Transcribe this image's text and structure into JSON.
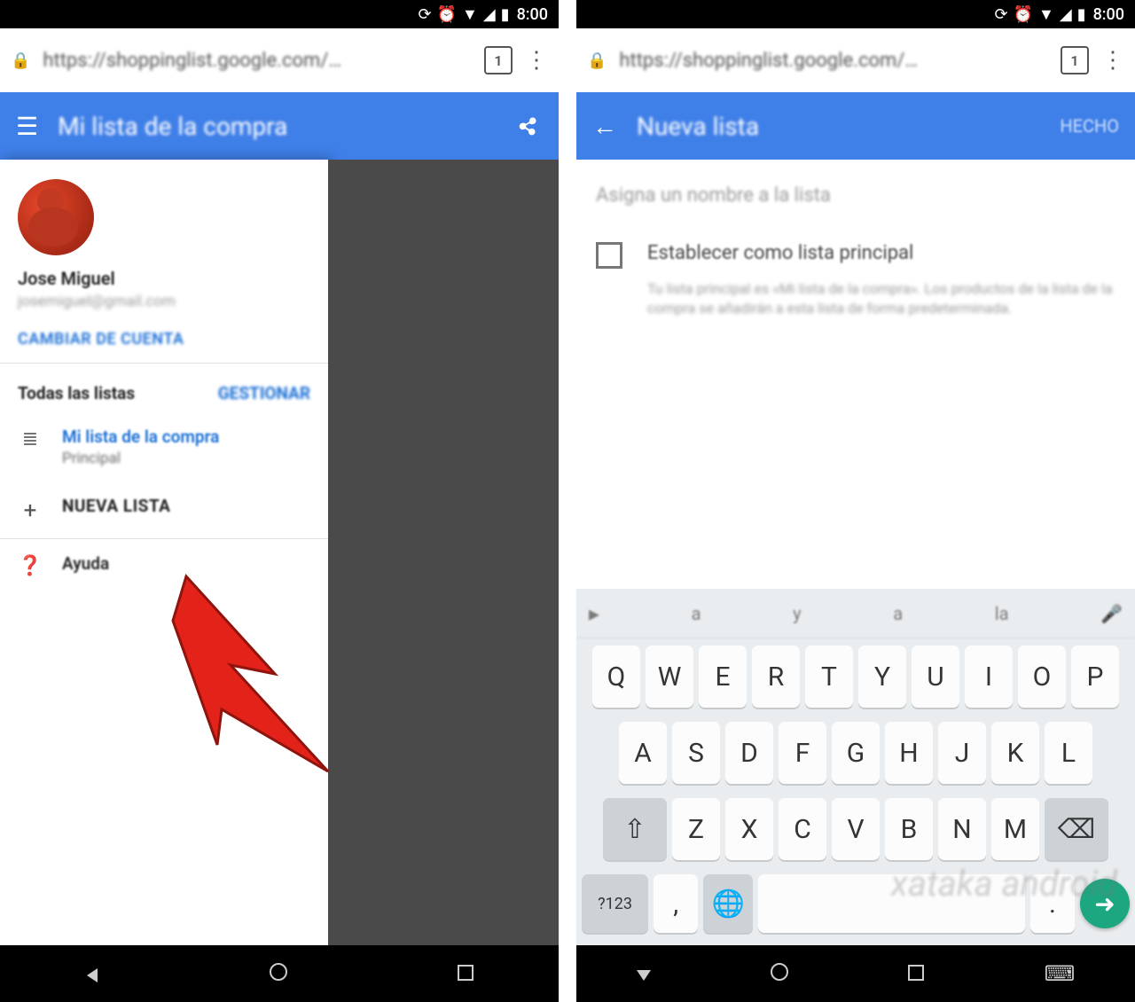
{
  "status": {
    "time": "8:00",
    "icons": [
      "sync-icon",
      "alarm-icon",
      "wifi-icon",
      "signal-icon",
      "battery-icon"
    ]
  },
  "browser": {
    "url": "https://shoppinglist.google.com/…",
    "tab_count": "1"
  },
  "left": {
    "header_title": "Mi lista de la compra",
    "drawer": {
      "account_name": "Jose Miguel",
      "account_email": "josemiguel@gmail.com",
      "switch_account": "CAMBIAR DE CUENTA",
      "section_label": "Todas las listas",
      "manage_label": "GESTIONAR",
      "primary_list": {
        "title": "Mi lista de la compra",
        "subtitle": "Principal"
      },
      "new_list": "NUEVA LISTA",
      "help": "Ayuda"
    }
  },
  "right": {
    "header_title": "Nueva lista",
    "header_action": "HECHO",
    "name_placeholder": "Asigna un nombre a la lista",
    "checkbox_label": "Establecer como lista principal",
    "checkbox_desc": "Tu lista principal es «Mi lista de la compra». Los productos de la lista de la compra se añadirán a esta lista de forma predeterminada."
  },
  "keyboard": {
    "suggestions": [
      "▶",
      "a",
      "y",
      "a",
      "la",
      "🎤"
    ],
    "row1": [
      "Q",
      "W",
      "E",
      "R",
      "T",
      "Y",
      "U",
      "I",
      "O",
      "P"
    ],
    "row2": [
      "A",
      "S",
      "D",
      "F",
      "G",
      "H",
      "J",
      "K",
      "L"
    ],
    "row3": [
      "Z",
      "X",
      "C",
      "V",
      "B",
      "N",
      "M"
    ],
    "shift": "⇧",
    "backspace": "⌫",
    "symbols": "?123",
    "comma": ",",
    "globe": "🌐",
    "space": " ",
    "period": ".",
    "enter": "➜"
  },
  "nav": {
    "back": "◁",
    "home": "○",
    "recent": "□",
    "keyboard_hide": "⌨"
  },
  "watermark": "xataka android"
}
